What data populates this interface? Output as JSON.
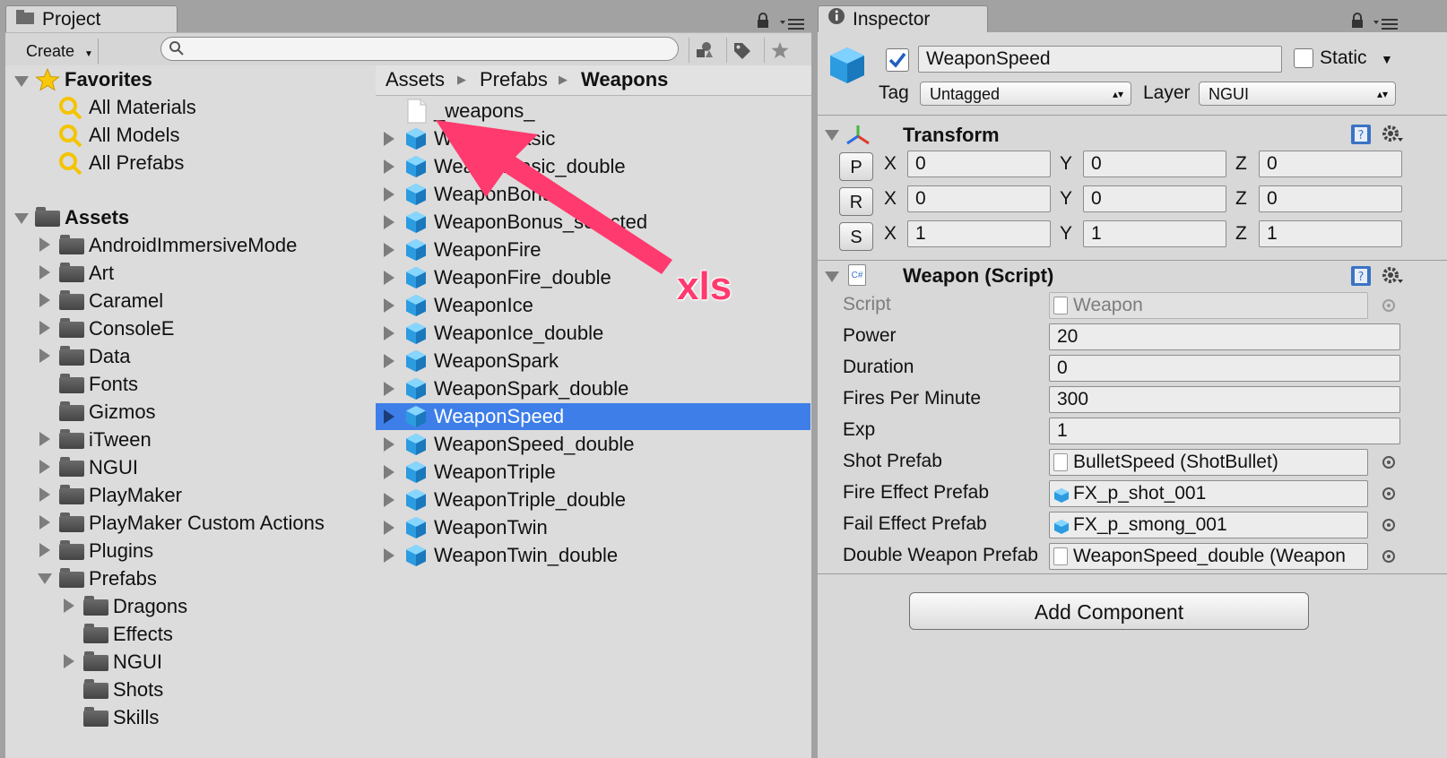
{
  "project": {
    "tab_title": "Project",
    "create_label": "Create",
    "search_placeholder": "",
    "favorites": {
      "title": "Favorites",
      "items": [
        "All Materials",
        "All Models",
        "All Prefabs"
      ]
    },
    "assets": {
      "title": "Assets",
      "folders": [
        "AndroidImmersiveMode",
        "Art",
        "Caramel",
        "ConsoleE",
        "Data",
        "Fonts",
        "Gizmos",
        "iTween",
        "NGUI",
        "PlayMaker",
        "PlayMaker Custom Actions",
        "Plugins",
        "Prefabs"
      ],
      "prefab_subfolders": [
        "Dragons",
        "Effects",
        "NGUI",
        "Shots",
        "Skills"
      ]
    },
    "breadcrumb": [
      "Assets",
      "Prefabs",
      "Weapons"
    ],
    "files": [
      "_weapons_",
      "WeaponBasic",
      "WeaponBasic_double",
      "WeaponBonus",
      "WeaponBonus_selected",
      "WeaponFire",
      "WeaponFire_double",
      "WeaponIce",
      "WeaponIce_double",
      "WeaponSpark",
      "WeaponSpark_double",
      "WeaponSpeed",
      "WeaponSpeed_double",
      "WeaponTriple",
      "WeaponTriple_double",
      "WeaponTwin",
      "WeaponTwin_double"
    ],
    "selected_file": "WeaponSpeed"
  },
  "annotation": {
    "text": "xls",
    "color": "#ff3a6e"
  },
  "inspector": {
    "tab_title": "Inspector",
    "object_name": "WeaponSpeed",
    "active_checked": true,
    "static_label": "Static",
    "tag_label": "Tag",
    "tag_value": "Untagged",
    "layer_label": "Layer",
    "layer_value": "NGUI",
    "transform": {
      "title": "Transform",
      "rows": [
        {
          "btn": "P",
          "x": "0",
          "y": "0",
          "z": "0"
        },
        {
          "btn": "R",
          "x": "0",
          "y": "0",
          "z": "0"
        },
        {
          "btn": "S",
          "x": "1",
          "y": "1",
          "z": "1"
        }
      ],
      "axis": [
        "X",
        "Y",
        "Z"
      ]
    },
    "script": {
      "title": "Weapon (Script)",
      "fields": [
        {
          "label": "Script",
          "value": "Weapon"
        },
        {
          "label": "Power",
          "value": "20"
        },
        {
          "label": "Duration",
          "value": "0"
        },
        {
          "label": "Fires Per Minute",
          "value": "300"
        },
        {
          "label": "Exp",
          "value": "1"
        },
        {
          "label": "Shot Prefab",
          "value": "BulletSpeed (ShotBullet)"
        },
        {
          "label": "Fire Effect Prefab",
          "value": "FX_p_shot_001"
        },
        {
          "label": "Fail Effect Prefab",
          "value": "FX_p_smong_001"
        },
        {
          "label": "Double Weapon Prefab",
          "value": "WeaponSpeed_double (Weapon"
        }
      ]
    },
    "add_component_label": "Add Component"
  }
}
